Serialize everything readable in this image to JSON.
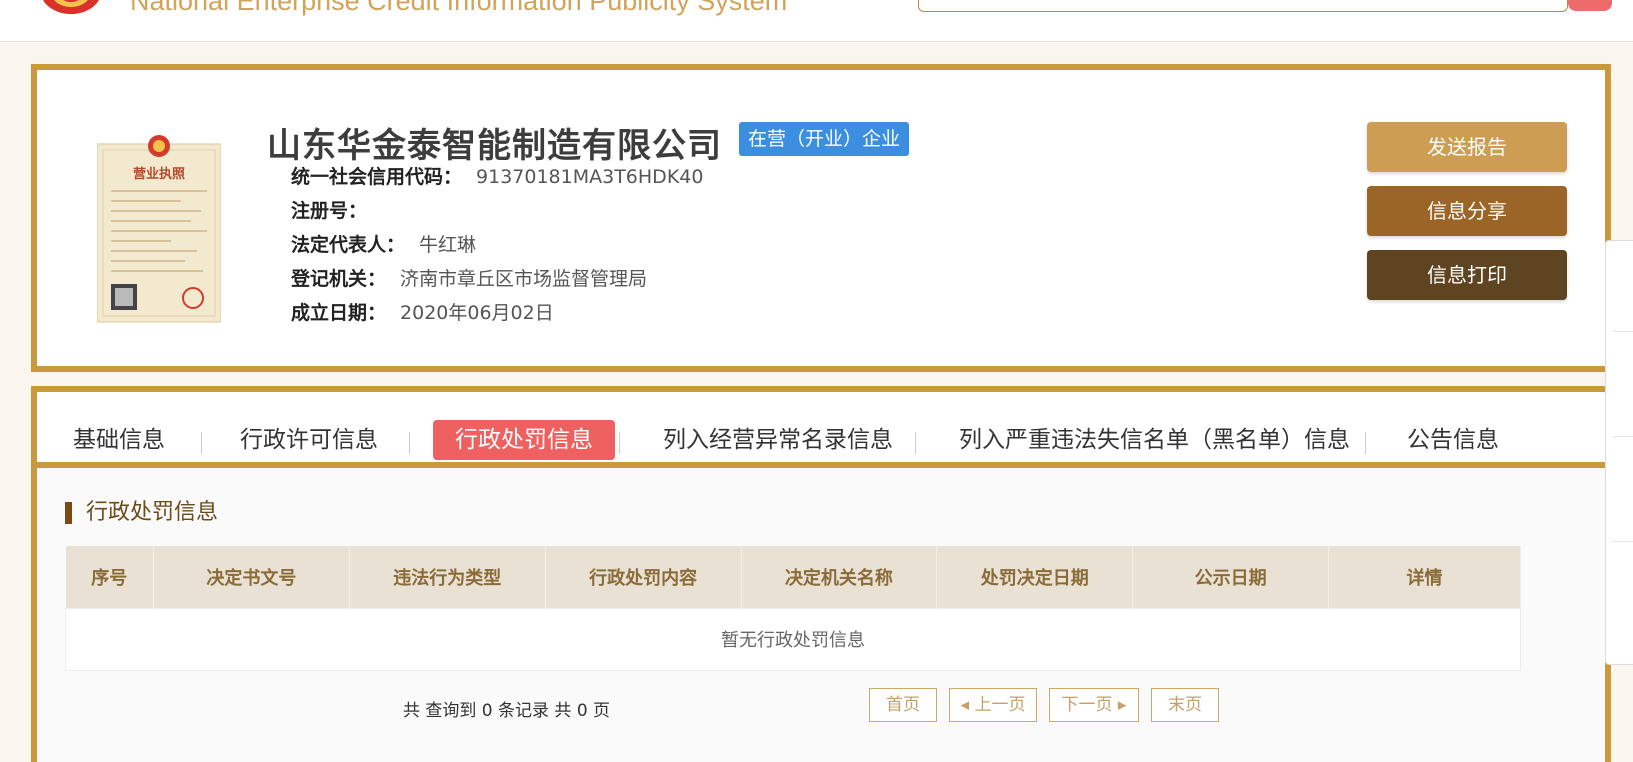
{
  "header": {
    "system_title": "National Enterprise Credit Information Publicity System"
  },
  "company": {
    "name": "山东华金泰智能制造有限公司",
    "status": "在营（开业）企业",
    "fields": [
      {
        "label": "统一社会信用代码：",
        "value": "91370181MA3T6HDK40"
      },
      {
        "label": "注册号：",
        "value": ""
      },
      {
        "label": "法定代表人：",
        "value": "牛红琳"
      },
      {
        "label": "登记机关：",
        "value": "济南市章丘区市场监督管理局"
      },
      {
        "label": "成立日期：",
        "value": "2020年06月02日"
      }
    ]
  },
  "license_image": {
    "title": "营业执照"
  },
  "actions": {
    "send_report": "发送报告",
    "share": "信息分享",
    "print": "信息打印"
  },
  "tabs": [
    {
      "label": "基础信息"
    },
    {
      "label": "行政许可信息"
    },
    {
      "label": "行政处罚信息"
    },
    {
      "label": "列入经营异常名录信息"
    },
    {
      "label": "列入严重违法失信名单（黑名单）信息"
    },
    {
      "label": "公告信息"
    }
  ],
  "section": {
    "title": "行政处罚信息",
    "columns": [
      "序号",
      "决定书文号",
      "违法行为类型",
      "行政处罚内容",
      "决定机关名称",
      "处罚决定日期",
      "公示日期",
      "详情"
    ],
    "empty_text": "暂无行政处罚信息"
  },
  "pager": {
    "summary": "共 查询到 0 条记录 共 0 页",
    "first": "首页",
    "prev": "上一页",
    "next": "下一页",
    "last": "末页"
  },
  "colors": {
    "gold_border": "#c9993c",
    "active_tab": "#ef6161",
    "status_blue": "#3c8fe0"
  }
}
